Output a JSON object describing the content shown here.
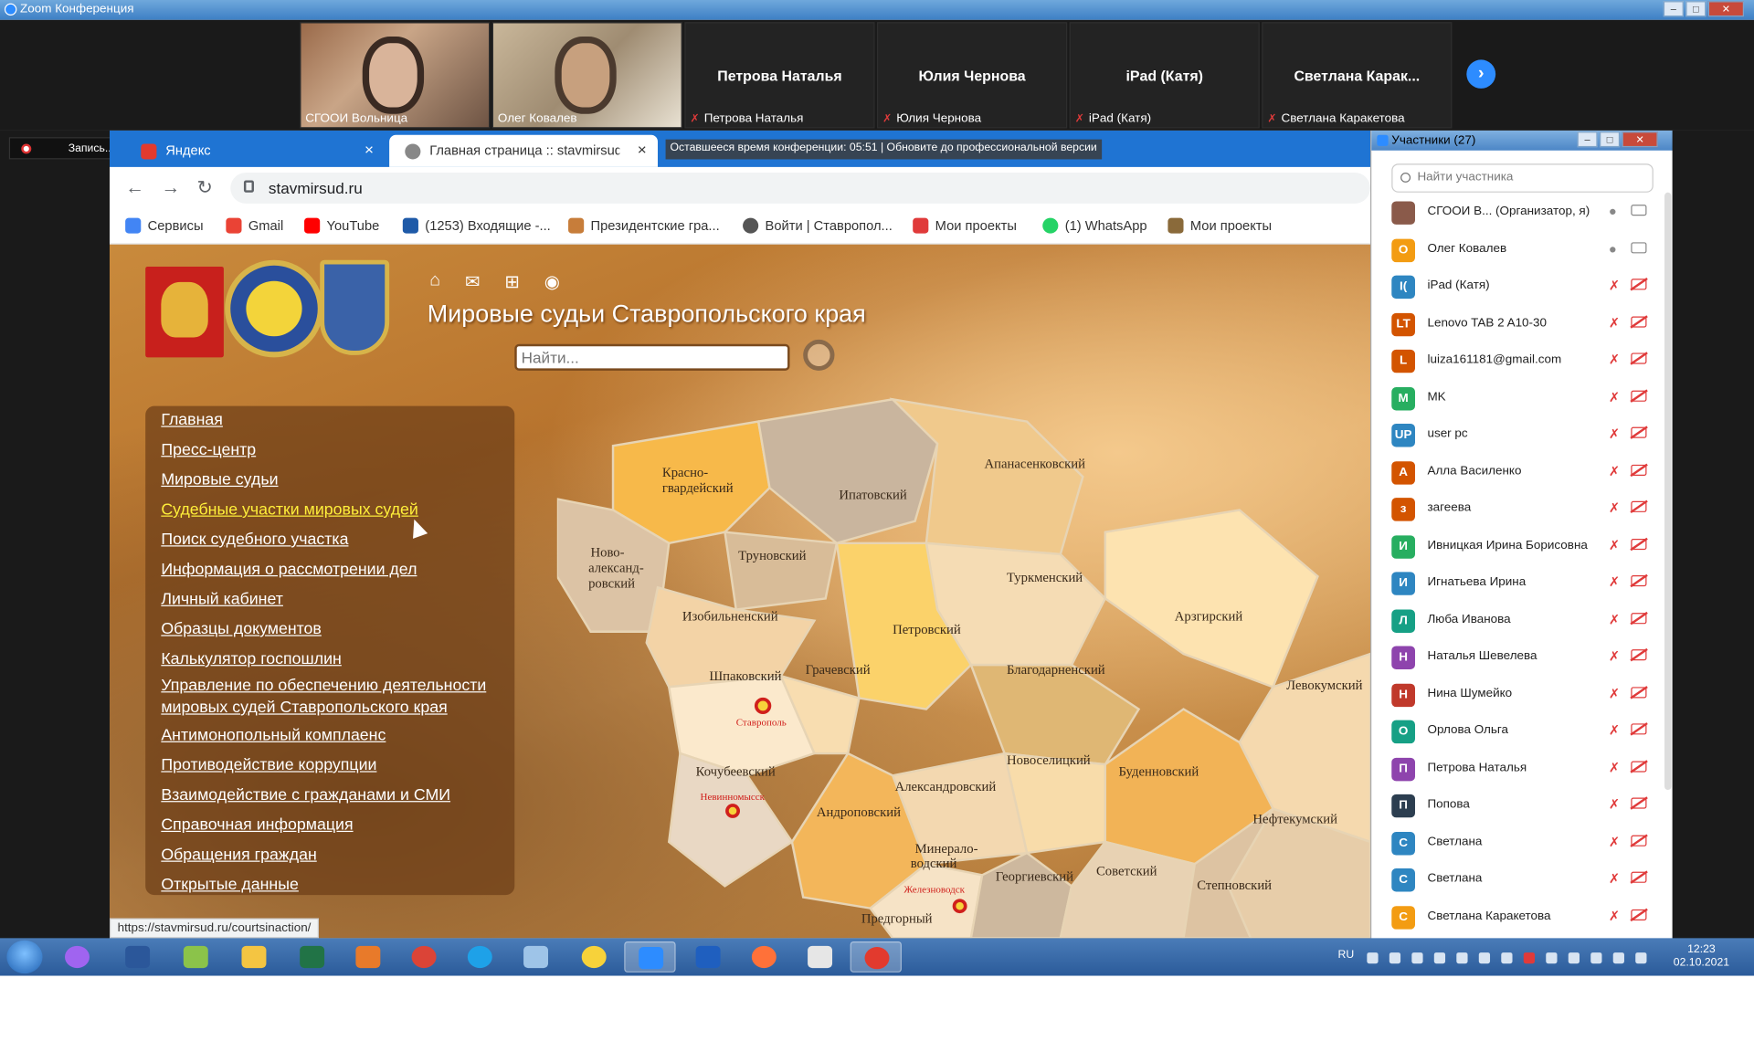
{
  "zoom": {
    "window_title": "Zoom Конференция",
    "recording_label": "Запись...",
    "remaining_time_banner": "Оставшееся время конференции: 05:51 | Обновите до профессиональной версии"
  },
  "video_tiles": [
    {
      "small_name": "СГООИ Вольница",
      "big_name": ""
    },
    {
      "small_name": "Олег Ковалев",
      "big_name": ""
    },
    {
      "small_name": "Петрова Наталья",
      "big_name": "Петрова Наталья"
    },
    {
      "small_name": "Юлия Чернова",
      "big_name": "Юлия Чернова"
    },
    {
      "small_name": "iPad (Катя)",
      "big_name": "iPad (Катя)"
    },
    {
      "small_name": "Светлана Каракетова",
      "big_name": "Светлана  Карак..."
    }
  ],
  "browser": {
    "tabs": [
      {
        "label": "Яндекс",
        "close": "×"
      },
      {
        "label": "Главная страница :: stavmirsud.r",
        "close": "×"
      }
    ],
    "url": "stavmirsud.ru",
    "bookmarks": [
      "Сервисы",
      "Gmail",
      "YouTube",
      "(1253) Входящие -...",
      "Президентские гра...",
      "Войти | Ставропол...",
      "Мои проекты",
      "(1) WhatsApp",
      "Мои проекты"
    ],
    "status_url": "https://stavmirsud.ru/courtsinaction/"
  },
  "site": {
    "title": "Мировые судьи Ставропольского края",
    "search_placeholder": "Найти...",
    "menu": [
      "Главная",
      "Пресс-центр",
      "Мировые судьи",
      "Судебные участки мировых судей",
      "Поиск судебного участка",
      "Информация о рассмотрении дел",
      "Личный кабинет",
      "Образцы документов",
      "Калькулятор госпошлин",
      "Управление по обеспечению деятельности",
      "мировых судей Ставропольского края",
      "Антимонопольный комплаенс",
      "Противодействие коррупции",
      "Взаимодействие с гражданами и СМИ",
      "Справочная информация",
      "Обращения граждан",
      "Открытые данные"
    ],
    "map_regions": [
      "Красно-",
      "гвардейский",
      "Ипатовский",
      "Апанасенковский",
      "Ново-",
      "александ-",
      "ровский",
      "Труновский",
      "Изобильненский",
      "Туркменский",
      "Арзгирский",
      "Петровский",
      "Шпаковский",
      "Грачевский",
      "Благодарненский",
      "Левокумский",
      "Кочубеевский",
      "Новоселицкий",
      "Буденновский",
      "Александровский",
      "Андроповский",
      "Нефтекумский",
      "Минерало-",
      "водский",
      "Георгиевский",
      "Советский",
      "Степновский",
      "Предгорный"
    ],
    "map_cities": [
      "Ставрополь",
      "Невинномысск",
      "Железноводск"
    ]
  },
  "participants": {
    "title": "Участники (27)",
    "search_placeholder": "Найти участника",
    "list": [
      {
        "initials": "",
        "name": "СГООИ В...  (Организатор, я)",
        "color": "#8a5a4a",
        "muted": false
      },
      {
        "initials": "О",
        "name": "Олег Ковалев",
        "color": "#f39c12",
        "muted": false
      },
      {
        "initials": "I(",
        "name": "iPad (Катя)",
        "color": "#2e86c1",
        "muted": true
      },
      {
        "initials": "LT",
        "name": "Lenovo TAB 2 A10-30",
        "color": "#d35400",
        "muted": true
      },
      {
        "initials": "L",
        "name": "luiza161181@gmail.com",
        "color": "#d35400",
        "muted": true
      },
      {
        "initials": "M",
        "name": "MK",
        "color": "#27ae60",
        "muted": true
      },
      {
        "initials": "UP",
        "name": "user pc",
        "color": "#2e86c1",
        "muted": true
      },
      {
        "initials": "А",
        "name": "Алла Василенко",
        "color": "#d35400",
        "muted": true
      },
      {
        "initials": "з",
        "name": "загеева",
        "color": "#d35400",
        "muted": true
      },
      {
        "initials": "И",
        "name": "Ивницкая Ирина Борисовна",
        "color": "#27ae60",
        "muted": true
      },
      {
        "initials": "И",
        "name": "Игнатьева Ирина",
        "color": "#2e86c1",
        "muted": true
      },
      {
        "initials": "Л",
        "name": "Люба Иванова",
        "color": "#16a085",
        "muted": true
      },
      {
        "initials": "Н",
        "name": "Наталья Шевелева",
        "color": "#8e44ad",
        "muted": true
      },
      {
        "initials": "Н",
        "name": "Нина Шумейко",
        "color": "#c0392b",
        "muted": true
      },
      {
        "initials": "О",
        "name": "Орлова Ольга",
        "color": "#16a085",
        "muted": true
      },
      {
        "initials": "П",
        "name": "Петрова Наталья",
        "color": "#8e44ad",
        "muted": true
      },
      {
        "initials": "П",
        "name": "Попова",
        "color": "#2c3e50",
        "muted": true
      },
      {
        "initials": "С",
        "name": "Светлана",
        "color": "#2e86c1",
        "muted": true
      },
      {
        "initials": "С",
        "name": "Светлана",
        "color": "#2e86c1",
        "muted": true
      },
      {
        "initials": "С",
        "name": "Светлана Каракетова",
        "color": "#f39c12",
        "muted": true
      }
    ]
  },
  "taskbar": {
    "lang": "RU",
    "time": "12:23",
    "date": "02.10.2021"
  }
}
